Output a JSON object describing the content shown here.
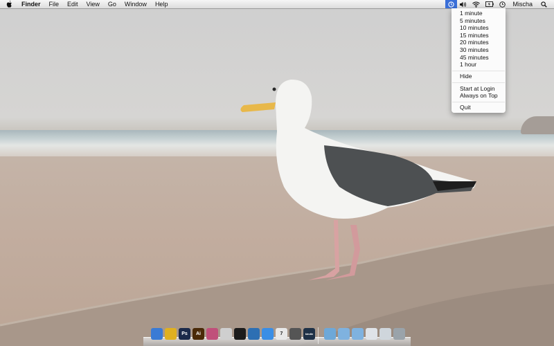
{
  "menubar": {
    "app_name": "Finder",
    "menus": [
      "File",
      "Edit",
      "View",
      "Go",
      "Window",
      "Help"
    ],
    "user_name": "Mischa"
  },
  "dropdown": {
    "time_options": [
      "1 minute",
      "5 minutes",
      "10 minutes",
      "15 minutes",
      "20 minutes",
      "30 minutes",
      "45 minutes",
      "1 hour"
    ],
    "hide_label": "Hide",
    "start_at_login_label": "Start at Login",
    "always_on_top_label": "Always on Top",
    "quit_label": "Quit"
  },
  "dock": {
    "apps": [
      {
        "name": "finder-icon",
        "label": "",
        "color": "#3a7bd5"
      },
      {
        "name": "chrome-icon",
        "label": "",
        "color": "#e0b020"
      },
      {
        "name": "photoshop-icon",
        "label": "Ps",
        "color": "#1b2a4a"
      },
      {
        "name": "illustrator-icon",
        "label": "Ai",
        "color": "#4a2a08"
      },
      {
        "name": "colorsync-icon",
        "label": "",
        "color": "#c0507a"
      },
      {
        "name": "script-editor-icon",
        "label": "",
        "color": "#cfcfcf"
      },
      {
        "name": "terminal-icon",
        "label": "",
        "color": "#1c1c1c"
      },
      {
        "name": "xcode-icon",
        "label": "",
        "color": "#2d6fb3"
      },
      {
        "name": "itunes-icon",
        "label": "",
        "color": "#3a8ee6"
      },
      {
        "name": "calendar-icon",
        "label": "7",
        "color": "#e8e8e8"
      },
      {
        "name": "pen-icon",
        "label": "",
        "color": "#555555"
      },
      {
        "name": "kindle-icon",
        "label": "kindle",
        "color": "#1f3147"
      }
    ],
    "folders": [
      {
        "name": "applications-folder-icon",
        "color": "#6ea8d8"
      },
      {
        "name": "documents-folder-icon",
        "color": "#7fb2df"
      },
      {
        "name": "downloads-folder-icon",
        "color": "#7fb2df"
      },
      {
        "name": "stack-icon",
        "color": "#dfe3e8"
      },
      {
        "name": "window-stack-icon",
        "color": "#cfd6dc"
      },
      {
        "name": "trash-icon",
        "color": "#9aa3aa"
      }
    ]
  }
}
